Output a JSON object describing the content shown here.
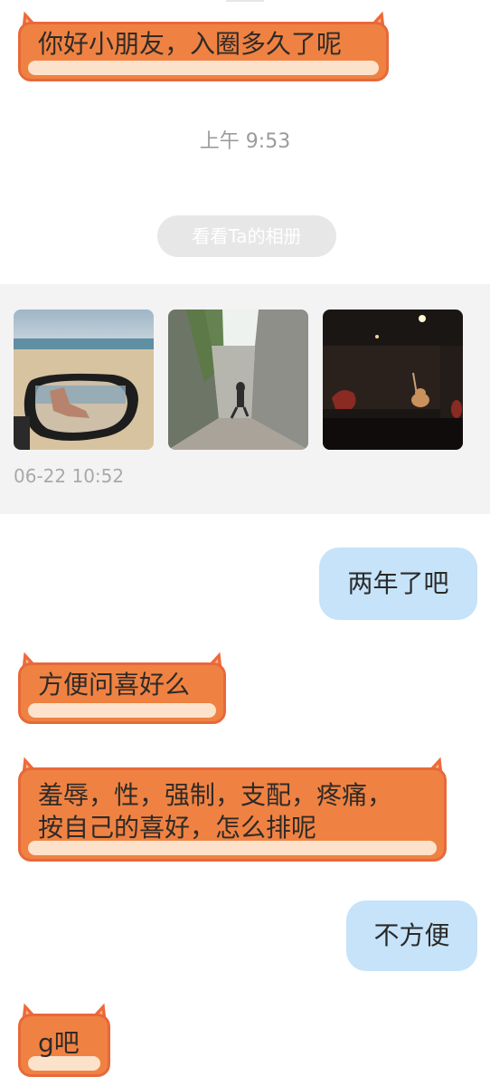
{
  "messages": {
    "m1": "你好小朋友，入圈多久了呢",
    "m2": "两年了吧",
    "m3": "方便问喜好么",
    "m4_line1": "羞辱，性，强制，支配，疼痛，",
    "m4_line2": "按自己的喜好，怎么排呢",
    "m5": "不方便",
    "m6": "g吧"
  },
  "timestamps": {
    "t1": "上午 9:53"
  },
  "album": {
    "button_label": "看看Ta的相册",
    "date": "06-22 10:52"
  },
  "colors": {
    "incoming_bubble": "#ef8242",
    "incoming_trim": "#fde2cb",
    "outgoing_bubble": "#c6e3f9",
    "album_bg": "#f3f3f3"
  }
}
